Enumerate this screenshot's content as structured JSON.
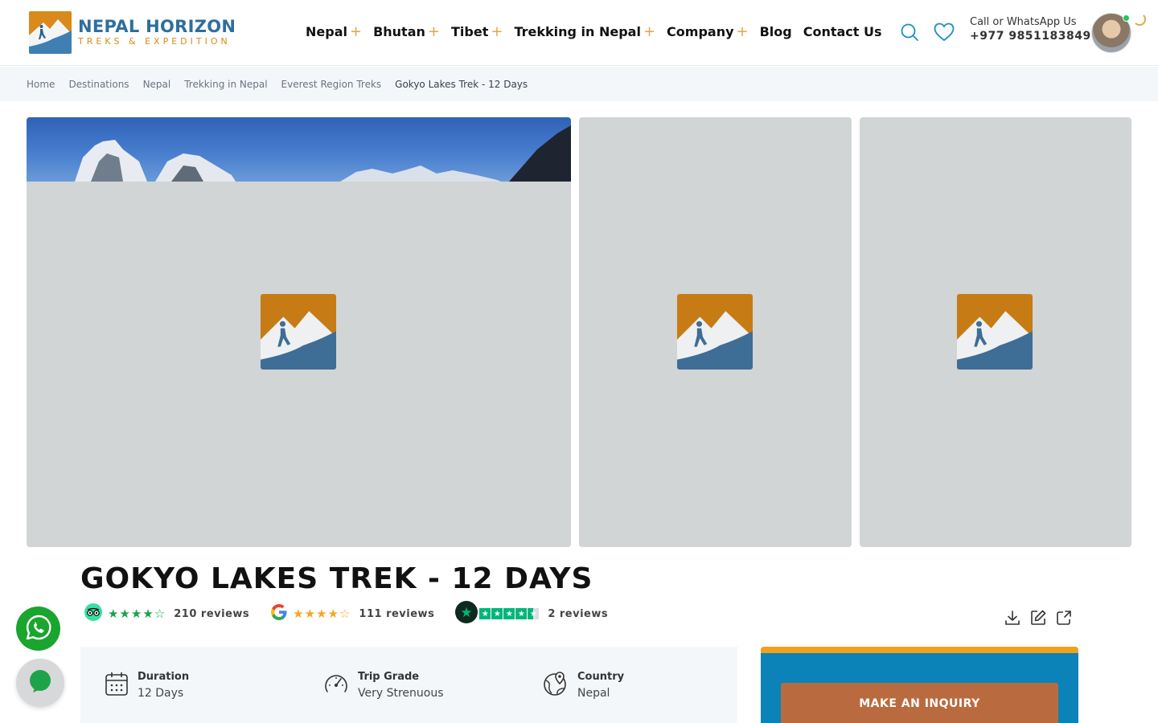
{
  "brand": {
    "title": "NEPAL HORIZON",
    "subtitle": "TREKS & EXPEDITION",
    "colors": {
      "blue": "#2e6e9e",
      "orange": "#d88a1c"
    }
  },
  "nav": {
    "items": [
      {
        "label": "Nepal",
        "has_sub": true
      },
      {
        "label": "Bhutan",
        "has_sub": true
      },
      {
        "label": "Tibet",
        "has_sub": true
      },
      {
        "label": "Trekking in Nepal",
        "has_sub": true
      },
      {
        "label": "Company",
        "has_sub": true
      },
      {
        "label": "Blog",
        "has_sub": false
      },
      {
        "label": "Contact Us",
        "has_sub": false
      }
    ],
    "plus": "+"
  },
  "header": {
    "call_label": "Call or WhatsApp Us",
    "phone": "+977 9851183849",
    "icons": [
      "search-icon",
      "heart-icon"
    ]
  },
  "breadcrumb": [
    "Home",
    "Destinations",
    "Nepal",
    "Trekking in Nepal",
    "Everest Region Treks",
    "Gokyo Lakes Trek - 12 Days"
  ],
  "trip": {
    "title": "GOKYO LAKES TREK - 12 DAYS"
  },
  "ratings": {
    "tripadvisor": {
      "reviews": "210 reviews",
      "stars": 4.5
    },
    "google": {
      "reviews": "111 reviews",
      "stars": 4.5
    },
    "trustpilot": {
      "reviews": "2 reviews",
      "stars": 4.5
    }
  },
  "facts": [
    {
      "label": "Duration",
      "value": "12 Days",
      "icon": "calendar-icon"
    },
    {
      "label": "Trip Grade",
      "value": "Very Strenuous",
      "icon": "speedometer-icon"
    },
    {
      "label": "Country",
      "value": "Nepal",
      "icon": "globe-pin-icon"
    }
  ],
  "inquiry": {
    "button": "MAKE AN INQUIRY",
    "colors": {
      "bg": "#0b83b8",
      "top": "#f0a21c",
      "button": "#b96b3f"
    }
  }
}
